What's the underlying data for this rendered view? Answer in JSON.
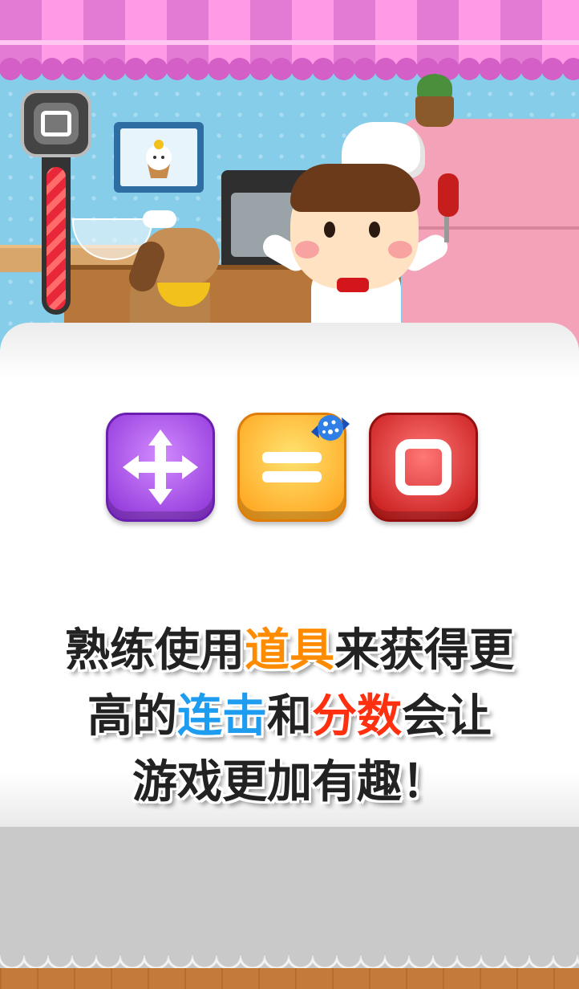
{
  "gauge": {
    "fill_fraction": 0.88,
    "fill_color": "#e8283a"
  },
  "items": [
    {
      "name": "move-item",
      "icon": "four-way-arrow-icon",
      "color": "#a14be3"
    },
    {
      "name": "line-clear-item",
      "icon": "double-bar-icon",
      "color": "#ffc22e"
    },
    {
      "name": "block-item",
      "icon": "square-frame-icon",
      "color": "#e23030"
    }
  ],
  "candy_icon": "blue-candy-icon",
  "message": {
    "line1_a": "熟练使用",
    "line1_hl": "道具",
    "line1_b": "来获得更",
    "line2_a": "高的",
    "line2_hl1": "连击",
    "line2_mid": "和",
    "line2_hl2": "分数",
    "line2_b": "会让",
    "line3": "游戏更加有趣！"
  },
  "colors": {
    "highlight_orange": "#ff8c00",
    "highlight_blue": "#1e9cf0",
    "highlight_red": "#ff3010"
  }
}
